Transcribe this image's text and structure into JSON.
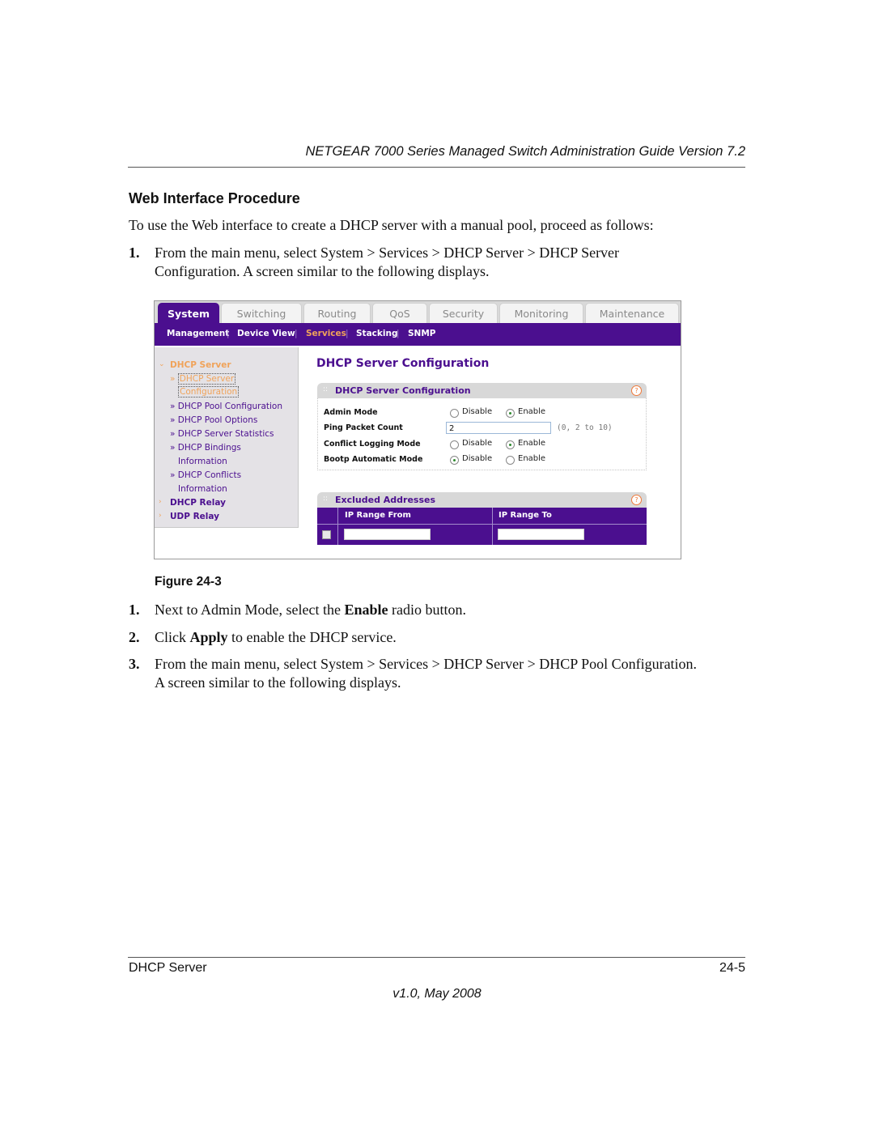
{
  "page": {
    "running_header": "NETGEAR 7000 Series Managed Switch Administration Guide Version 7.2",
    "section_heading": "Web Interface Procedure",
    "intro": "To use the Web interface to create a DHCP server with a manual pool, proceed as follows:",
    "steps_before": [
      {
        "num": "1.",
        "line1": "From the main menu, select System > Services > DHCP Server > DHCP Server",
        "line2": "Configuration. A screen similar to the following displays."
      }
    ],
    "figure_caption": "Figure 24-3",
    "steps_after": [
      {
        "num": "1.",
        "pre": "Next to Admin Mode, select the ",
        "bold": "Enable",
        "post": " radio button."
      },
      {
        "num": "2.",
        "pre": "Click ",
        "bold": "Apply",
        "post": " to enable the DHCP service."
      },
      {
        "num": "3.",
        "line1": "From the main menu, select System > Services > DHCP Server > DHCP Pool Configuration.",
        "line2": "A screen similar to the following displays."
      }
    ],
    "footer_left": "DHCP Server",
    "footer_right": "24-5",
    "footer_version": "v1.0, May 2008"
  },
  "screenshot": {
    "tabs": [
      "System",
      "Switching",
      "Routing",
      "QoS",
      "Security",
      "Monitoring",
      "Maintenance"
    ],
    "active_tab": "System",
    "subnav": [
      "Management",
      "Device View",
      "Services",
      "Stacking",
      "SNMP"
    ],
    "active_subnav": "Services",
    "sidebar": {
      "dhcp_server": "DHCP Server",
      "selected_line1": "DHCP Server",
      "selected_line2": "Configuration",
      "items": [
        {
          "line1": "DHCP Pool Configuration"
        },
        {
          "line1": "DHCP Pool Options"
        },
        {
          "line1": "DHCP Server Statistics"
        },
        {
          "line1": "DHCP Bindings",
          "line2": "Information"
        },
        {
          "line1": "DHCP Conflicts",
          "line2": "Information"
        }
      ],
      "dhcp_relay": "DHCP Relay",
      "udp_relay": "UDP Relay"
    },
    "main_title": "DHCP Server Configuration",
    "config_panel": {
      "title": "DHCP Server Configuration",
      "admin_mode_label": "Admin Mode",
      "admin_mode_value": "Enable",
      "ping_packet_count_label": "Ping Packet Count",
      "ping_packet_count_value": "2",
      "ping_packet_count_hint": "(0, 2 to 10)",
      "conflict_logging_label": "Conflict Logging Mode",
      "conflict_logging_value": "Enable",
      "bootp_label": "Bootp Automatic Mode",
      "bootp_value": "Disable",
      "disable_label": "Disable",
      "enable_label": "Enable"
    },
    "excluded_panel": {
      "title": "Excluded Addresses",
      "col_from": "IP Range From",
      "col_to": "IP Range To",
      "from_value": "",
      "to_value": ""
    },
    "help_glyph": "?",
    "colors": {
      "accent": "#4b0f8f",
      "highlight": "#f0a35a",
      "help": "#f07a3a"
    }
  }
}
